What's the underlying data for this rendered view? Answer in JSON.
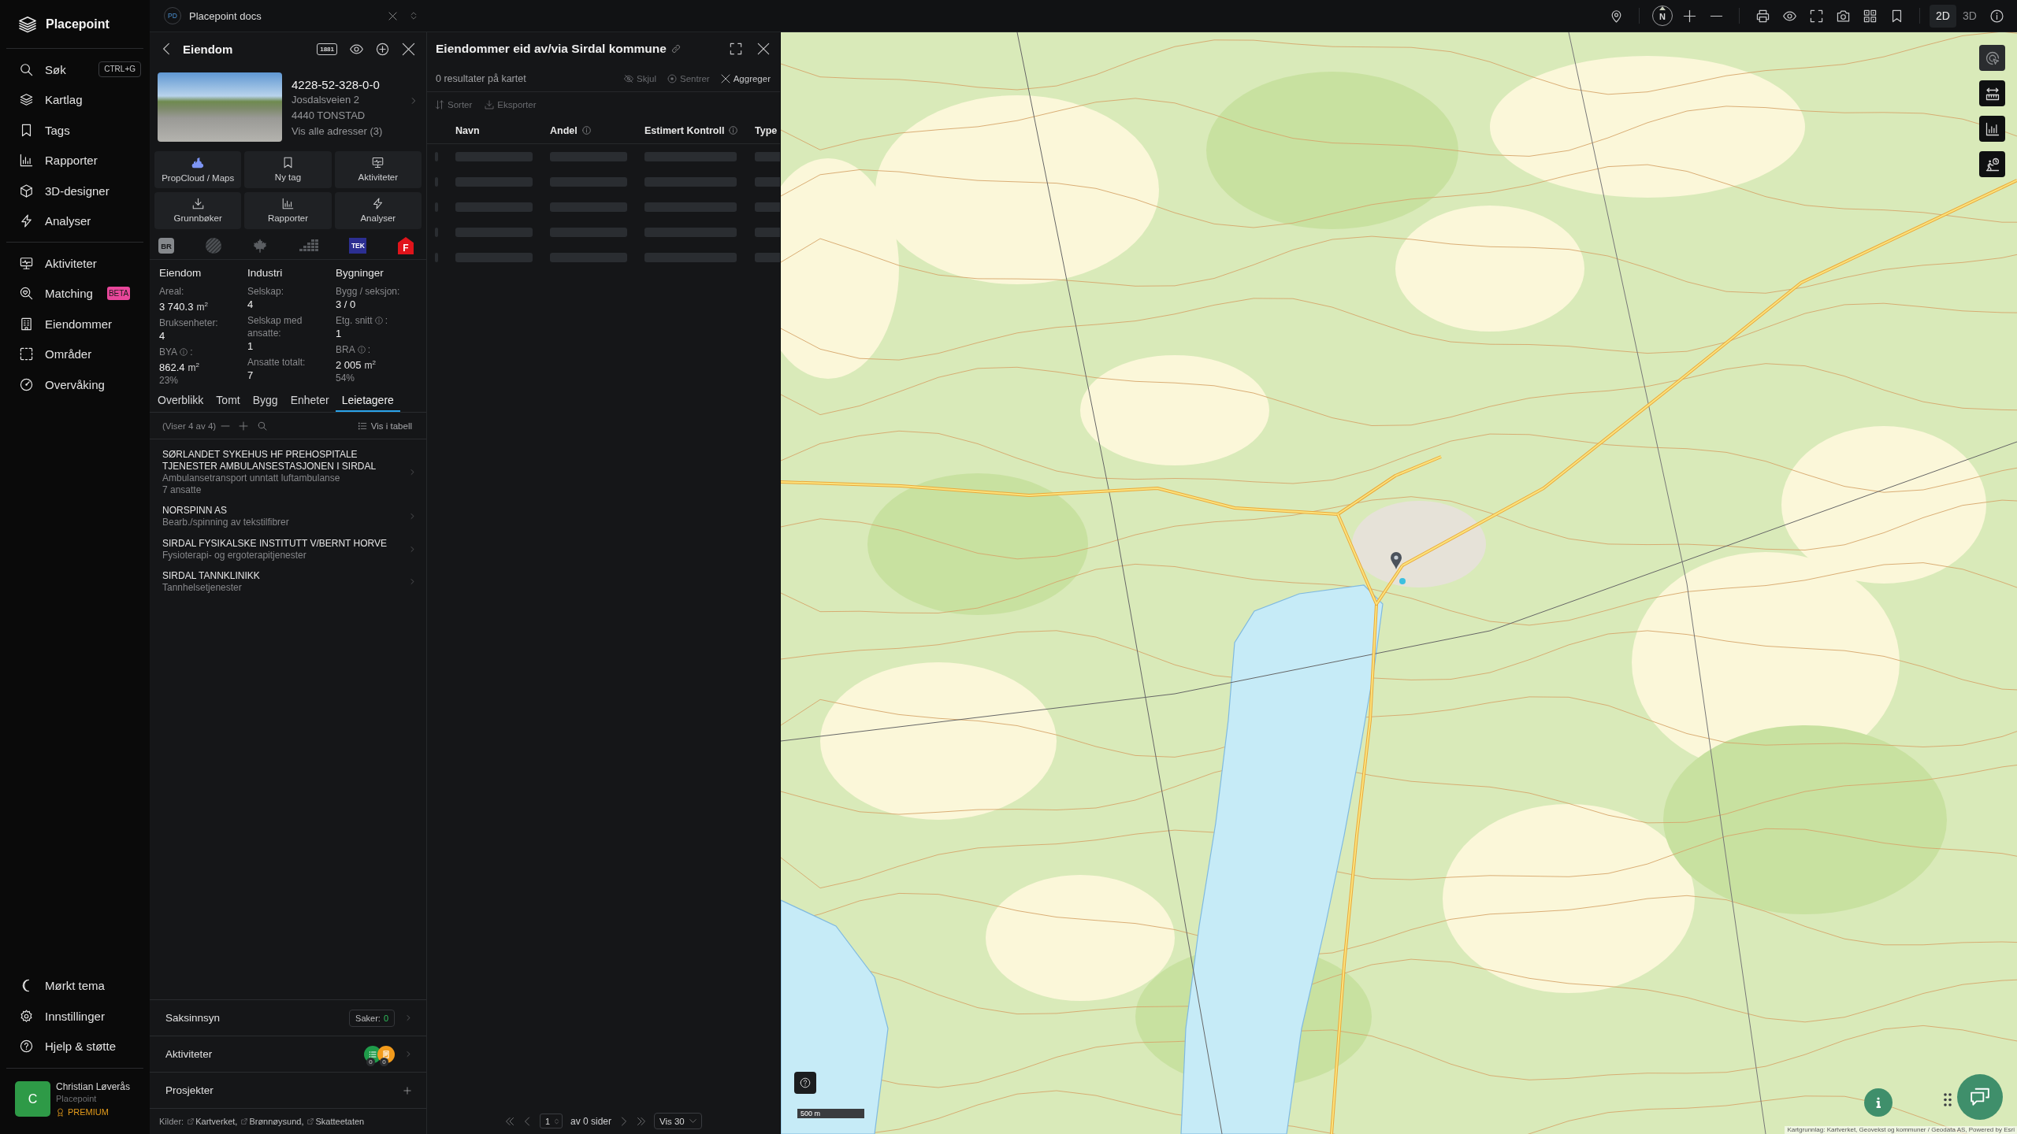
{
  "sidebar": {
    "brand": "Placepoint",
    "main_items": [
      {
        "label": "Søk",
        "shortcut": "CTRL+G"
      },
      {
        "label": "Kartlag"
      },
      {
        "label": "Tags"
      },
      {
        "label": "Rapporter"
      },
      {
        "label": "3D-designer"
      },
      {
        "label": "Analyser"
      }
    ],
    "secondary_items": [
      {
        "label": "Aktiviteter"
      },
      {
        "label": "Matching",
        "badge": "BETA"
      },
      {
        "label": "Eiendommer"
      },
      {
        "label": "Områder"
      },
      {
        "label": "Overvåking"
      }
    ],
    "bottom_items": [
      {
        "label": "Mørkt tema"
      },
      {
        "label": "Innstillinger"
      },
      {
        "label": "Hjelp & støtte"
      }
    ],
    "user": {
      "initial": "C",
      "name": "Christian Løverås",
      "organization": "Placepoint",
      "plan": "PREMIUM"
    }
  },
  "workspace_tab": {
    "initials": "PD",
    "title": "Placepoint docs"
  },
  "property_panel": {
    "title": "Eiendom",
    "header_logo": "1881",
    "property_id": "4228-52-328-0-0",
    "address_lines": [
      "Josdalsveien 2",
      "4440 TONSTAD"
    ],
    "addresses_link": "Vis alle adresser (3)",
    "actions": [
      {
        "label": "PropCloud / Maps"
      },
      {
        "label": "Ny tag"
      },
      {
        "label": "Aktiviteter"
      },
      {
        "label": "Grunnbøker"
      },
      {
        "label": "Rapporter"
      },
      {
        "label": "Analyser"
      }
    ],
    "sources": [
      {
        "kind": "br",
        "label": "BR"
      },
      {
        "kind": "stripes"
      },
      {
        "kind": "leaf"
      },
      {
        "kind": "bars"
      },
      {
        "kind": "tek",
        "label": "TEK"
      },
      {
        "kind": "house",
        "label": "F"
      }
    ],
    "stats": [
      {
        "heading": "Eiendom",
        "items": [
          {
            "label": "Areal:",
            "value": "3 740.3",
            "unit": "m$^{2}$"
          },
          {
            "label": "Bruksenheter:",
            "value": "4"
          },
          {
            "label": "BYA",
            "info": true,
            "label_end": ":",
            "value": "862.4",
            "unit": "m$^{2}$",
            "share": "23%"
          }
        ]
      },
      {
        "heading": "Industri",
        "items": [
          {
            "label": "Selskap:",
            "value": "4"
          },
          {
            "label": "Selskap med ansatte:",
            "value": "1"
          },
          {
            "label": "Ansatte totalt:",
            "value": "7"
          }
        ]
      },
      {
        "heading": "Bygninger",
        "items": [
          {
            "label": "Bygg / seksjon:",
            "value": "3 / 0"
          },
          {
            "label": "Etg. snitt",
            "info": true,
            "label_end": ":",
            "value": "1"
          },
          {
            "label": "BRA",
            "info": true,
            "label_end": ":",
            "value": "2 005",
            "unit": "m$^{2}$",
            "share": "54%"
          }
        ]
      }
    ],
    "tabs": [
      {
        "label": "Overblikk",
        "selected": false
      },
      {
        "label": "Tomt",
        "selected": false
      },
      {
        "label": "Bygg",
        "selected": false
      },
      {
        "label": "Enheter",
        "selected": false
      },
      {
        "label": "Leietagere",
        "selected": true
      }
    ],
    "list_count": "(Viser 4 av 4)",
    "table_view": "Vis i tabell",
    "tenants": [
      {
        "name": "SØRLANDET SYKEHUS HF PREHOSPITALE TJENESTER AMBULANSESTASJONEN I SIRDAL",
        "activity": "Ambulansetransport unntatt luftambulanse",
        "employees": "7 ansatte"
      },
      {
        "name": "NORSPINN AS",
        "activity": "Bearb./spinning av tekstilfibrer"
      },
      {
        "name": "SIRDAL FYSIKALSKE INSTITUTT V/BERNT HORVE",
        "activity": "Fysioterapi- og ergoterapitjenester"
      },
      {
        "name": "SIRDAL TANNKLINIKK",
        "activity": "Tannhelsetjenester"
      }
    ],
    "sections": [
      {
        "kind": "cases",
        "label": "Saksinnsyn",
        "badge_label": "Saker:",
        "badge_count": "0"
      },
      {
        "kind": "activities",
        "label": "Aktiviteter",
        "counts": [
          {
            "count": "0",
            "color": "#1f9b4a"
          },
          {
            "count": "0",
            "color": "#f29b1c"
          }
        ]
      },
      {
        "kind": "projects",
        "label": "Prosjekter"
      }
    ],
    "sources_footer": {
      "label": "Kilder:",
      "links": [
        "Kartverket,",
        "Brønnøysund,",
        "Skatteetaten"
      ]
    }
  },
  "ownership_panel": {
    "title": "Eiendommer eid av/via Sirdal kommune",
    "result_count": "0 resultater på kartet",
    "map_actions": [
      {
        "label": "Skjul",
        "disabled": true
      },
      {
        "label": "Sentrer",
        "disabled": true
      },
      {
        "label": "Aggreger",
        "disabled": false
      }
    ],
    "table_actions": [
      {
        "label": "Sorter",
        "disabled": true
      },
      {
        "label": "Eksporter",
        "disabled": true
      }
    ],
    "table": {
      "columns": [
        {
          "label": "Navn"
        },
        {
          "label": "Andel",
          "info": true
        },
        {
          "label": "Estimert Kontroll",
          "info": true
        },
        {
          "label": "Type"
        }
      ],
      "loading": true
    },
    "pagination": {
      "page": "1",
      "pages_label": "av 0 sider",
      "page_size": "Vis 30"
    }
  },
  "map": {
    "compass": "N",
    "view_modes": [
      {
        "label": "2D",
        "selected": true
      },
      {
        "label": "3D",
        "selected": false
      }
    ],
    "side_tools": [
      {
        "selected": true
      },
      {
        "selected": false
      },
      {
        "selected": false
      },
      {
        "selected": false
      }
    ],
    "scale": "500 m",
    "attribution": "Kartgrunnlag: Kartverket, Geovekst og kommuner / Geodata AS, Powered by Esri"
  }
}
